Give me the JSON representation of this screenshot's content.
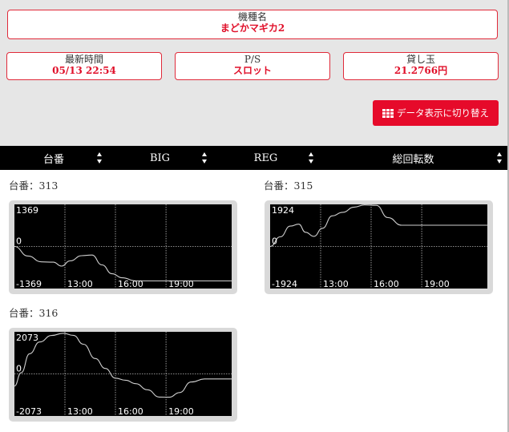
{
  "header": {
    "model": {
      "label": "機種名",
      "value": "まどかマギカ2"
    },
    "updated": {
      "label": "最新時間",
      "value": "05/13 22:54"
    },
    "ps": {
      "label": "P/S",
      "value": "スロット"
    },
    "rate": {
      "label": "貸し玉",
      "value": "21.2766円"
    }
  },
  "switch_button": {
    "label": "データ表示に切り替え",
    "icon": "grid-icon"
  },
  "table": {
    "columns": [
      "台番",
      "BIG",
      "REG",
      "総回転数"
    ]
  },
  "colors": {
    "accent": "#e0102a",
    "header_bg": "#000000",
    "chart_bg": "#000000"
  },
  "chart_data": [
    {
      "type": "line",
      "title": "台番：313",
      "ylim": [
        -1369,
        1369
      ],
      "y_tick_labels": [
        "1369",
        "0",
        "-1369"
      ],
      "x_tick_labels": [
        "13:00",
        "16:00",
        "19:00"
      ],
      "x": [
        10.0,
        10.8,
        11.6,
        12.3,
        12.8,
        13.3,
        14.0,
        14.6,
        15.2,
        15.8,
        16.4,
        17.2,
        18.4,
        19.6,
        20.8,
        22.9
      ],
      "y": [
        0,
        -310,
        -500,
        -510,
        -640,
        -470,
        -300,
        -280,
        -600,
        -890,
        -1020,
        -1120,
        -1120,
        -1120,
        -1120,
        -1120
      ],
      "grid": true
    },
    {
      "type": "line",
      "title": "台番：315",
      "ylim": [
        -1924,
        1924
      ],
      "y_tick_labels": [
        "1924",
        "0",
        "-1924"
      ],
      "x_tick_labels": [
        "13:00",
        "16:00",
        "19:00"
      ],
      "x": [
        10.0,
        10.6,
        11.2,
        11.7,
        12.1,
        12.6,
        13.1,
        13.7,
        14.3,
        15.0,
        15.6,
        16.3,
        17.0,
        17.8,
        19.0,
        20.3,
        22.9
      ],
      "y": [
        0,
        440,
        930,
        1020,
        650,
        460,
        830,
        1400,
        1560,
        1800,
        1900,
        1880,
        1320,
        970,
        970,
        970,
        970
      ],
      "grid": true
    },
    {
      "type": "line",
      "title": "台番：316",
      "ylim": [
        -2073,
        2073
      ],
      "y_tick_labels": [
        "2073",
        "0",
        "-2073"
      ],
      "x_tick_labels": [
        "13:00",
        "16:00",
        "19:00"
      ],
      "x": [
        10.0,
        10.4,
        10.9,
        11.5,
        12.2,
        12.9,
        13.5,
        14.1,
        14.8,
        15.4,
        16.0,
        16.6,
        17.2,
        17.9,
        18.6,
        19.2,
        19.8,
        20.5,
        21.3,
        22.9
      ],
      "y": [
        -600,
        60,
        990,
        1570,
        1890,
        2000,
        1900,
        1460,
        760,
        270,
        -210,
        -310,
        -480,
        -780,
        -1140,
        -1150,
        -920,
        -400,
        -250,
        -250
      ],
      "grid": true
    }
  ]
}
